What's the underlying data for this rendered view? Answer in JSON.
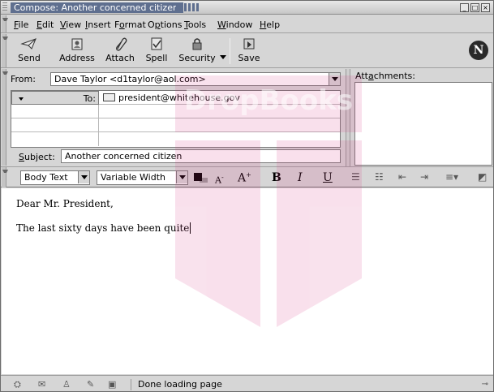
{
  "window": {
    "title": "Compose: Another concerned citizen"
  },
  "menu": {
    "items": [
      {
        "label": "File",
        "accel": "F",
        "rest": "ile"
      },
      {
        "label": "Edit",
        "accel": "E",
        "rest": "dit"
      },
      {
        "label": "View",
        "accel": "V",
        "rest": "iew"
      },
      {
        "label": "Insert",
        "accel": "I",
        "rest": "nsert"
      },
      {
        "label": "Format",
        "pre": "F",
        "accel": "o",
        "rest": "rmat"
      },
      {
        "label": "Options",
        "pre": "O",
        "accel": "p",
        "rest": "tions"
      },
      {
        "label": "Tools",
        "accel": "T",
        "rest": "ools"
      },
      {
        "label": "Window",
        "accel": "W",
        "rest": "indow"
      },
      {
        "label": "Help",
        "accel": "H",
        "rest": "elp"
      }
    ]
  },
  "toolbar": {
    "send": "Send",
    "address": "Address",
    "attach": "Attach",
    "spell": "Spell",
    "security": "Security",
    "save": "Save"
  },
  "header": {
    "from_label": "From:",
    "from_value": "Dave Taylor <d1taylor@aol.com>",
    "to_type": "To:",
    "to_address": "president@whitehouse.gov",
    "subject_label": "Subject:",
    "subject_value": "Another concerned citizen",
    "attachments_label": "Attachments:"
  },
  "format": {
    "paragraph_style": "Body Text",
    "font": "Variable Width",
    "smaller": "A",
    "larger": "A",
    "bold": "B",
    "italic": "I",
    "underline": "U"
  },
  "body": {
    "line1": "Dear Mr. President,",
    "line2": "The last sixty days have been quite"
  },
  "status": {
    "text": "Done loading page"
  },
  "watermark": {
    "text": "DropBooks",
    "color": "#d93a86"
  }
}
